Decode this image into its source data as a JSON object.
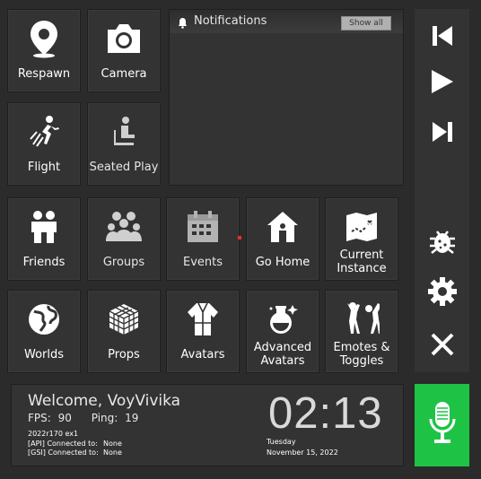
{
  "tiles": {
    "respawn": "Respawn",
    "camera": "Camera",
    "flight": "Flight",
    "seated_play": "Seated Play",
    "friends": "Friends",
    "groups": "Groups",
    "events": "Events",
    "go_home": "Go Home",
    "current_instance_l1": "Current",
    "current_instance_l2": "Instance",
    "worlds": "Worlds",
    "props": "Props",
    "avatars": "Avatars",
    "advanced_avatars_l1": "Advanced",
    "advanced_avatars_l2": "Avatars",
    "emotes_l1": "Emotes &",
    "emotes_l2": "Toggles"
  },
  "notifications": {
    "title": "Notifications",
    "show_all": "Show all"
  },
  "status": {
    "welcome": "Welcome, VoyVivika",
    "fps_label": "FPS:",
    "fps": "90",
    "ping_label": "Ping:",
    "ping": "19",
    "version": "2022r170 ex1",
    "api_label": "[API] Connected to:",
    "api_value": "None",
    "gsi_label": "[GSI] Connected to:",
    "gsi_value": "None",
    "time": "02:13",
    "weekday": "Tuesday",
    "date": "November 15, 2022"
  },
  "colors": {
    "tile": "#333333",
    "background": "#2b2b2b",
    "mic": "#1ec346",
    "alert_dot": "#e53030"
  },
  "icons": [
    "map-pin-icon",
    "camera-icon",
    "flight-icon",
    "seated-icon",
    "friends-icon",
    "groups-icon",
    "calendar-icon",
    "home-icon",
    "map-icon",
    "globe-icon",
    "cube-icon",
    "robe-icon",
    "potion-icon",
    "dance-icon",
    "skip-back-icon",
    "play-icon",
    "skip-forward-icon",
    "bug-icon",
    "gear-icon",
    "close-icon",
    "microphone-icon",
    "bell-icon"
  ]
}
